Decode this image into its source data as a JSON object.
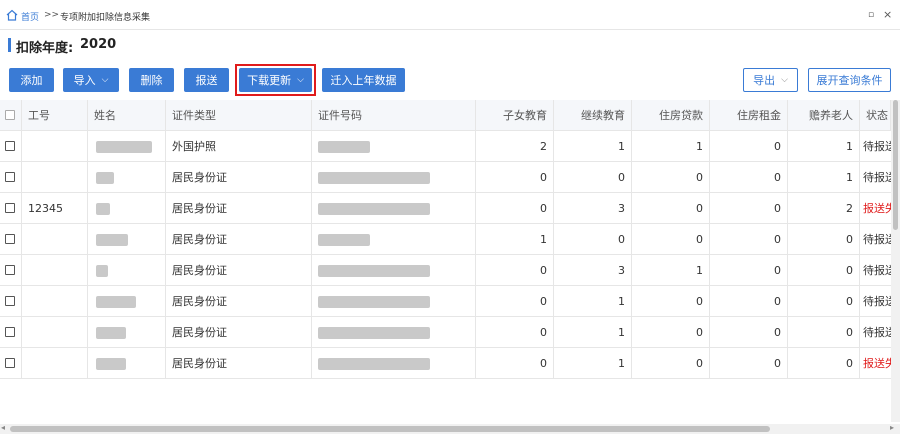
{
  "breadcrumb": {
    "home": "首页",
    "separator": ">>",
    "current": "专项附加扣除信息采集"
  },
  "window": {
    "restore_icon": "▫",
    "close_icon": "×"
  },
  "year": {
    "label": "扣除年度:",
    "value": "2020"
  },
  "toolbar": {
    "add": "添加",
    "import": "导入",
    "delete": "删除",
    "submit": "报送",
    "download_update": "下载更新",
    "migrate": "迁入上年数据",
    "export": "导出",
    "expand_query": "展开查询条件"
  },
  "colors": {
    "accent": "#3a7bd5",
    "highlight": "#e01b1b",
    "fail": "#e01b1b"
  },
  "table": {
    "columns": [
      "工号",
      "姓名",
      "证件类型",
      "证件号码",
      "子女教育",
      "继续教育",
      "住房贷款",
      "住房租金",
      "赡养老人",
      "状态"
    ],
    "rows": [
      {
        "emp_id": "",
        "id_type": "外国护照",
        "child_edu": "2",
        "cont_edu": "1",
        "housing_loan": "1",
        "housing_rent": "0",
        "elderly": "1",
        "status": "待报送"
      },
      {
        "emp_id": "",
        "id_type": "居民身份证",
        "child_edu": "0",
        "cont_edu": "0",
        "housing_loan": "0",
        "housing_rent": "0",
        "elderly": "1",
        "status": "待报送"
      },
      {
        "emp_id": "12345",
        "id_type": "居民身份证",
        "child_edu": "0",
        "cont_edu": "3",
        "housing_loan": "0",
        "housing_rent": "0",
        "elderly": "2",
        "status": "报送失败"
      },
      {
        "emp_id": "",
        "id_type": "居民身份证",
        "child_edu": "1",
        "cont_edu": "0",
        "housing_loan": "0",
        "housing_rent": "0",
        "elderly": "0",
        "status": "待报送"
      },
      {
        "emp_id": "",
        "id_type": "居民身份证",
        "child_edu": "0",
        "cont_edu": "3",
        "housing_loan": "1",
        "housing_rent": "0",
        "elderly": "0",
        "status": "待报送"
      },
      {
        "emp_id": "",
        "id_type": "居民身份证",
        "child_edu": "0",
        "cont_edu": "1",
        "housing_loan": "0",
        "housing_rent": "0",
        "elderly": "0",
        "status": "待报送"
      },
      {
        "emp_id": "",
        "id_type": "居民身份证",
        "child_edu": "0",
        "cont_edu": "1",
        "housing_loan": "0",
        "housing_rent": "0",
        "elderly": "0",
        "status": "待报送"
      },
      {
        "emp_id": "",
        "id_type": "居民身份证",
        "child_edu": "0",
        "cont_edu": "1",
        "housing_loan": "0",
        "housing_rent": "0",
        "elderly": "0",
        "status": "报送失败"
      }
    ]
  }
}
